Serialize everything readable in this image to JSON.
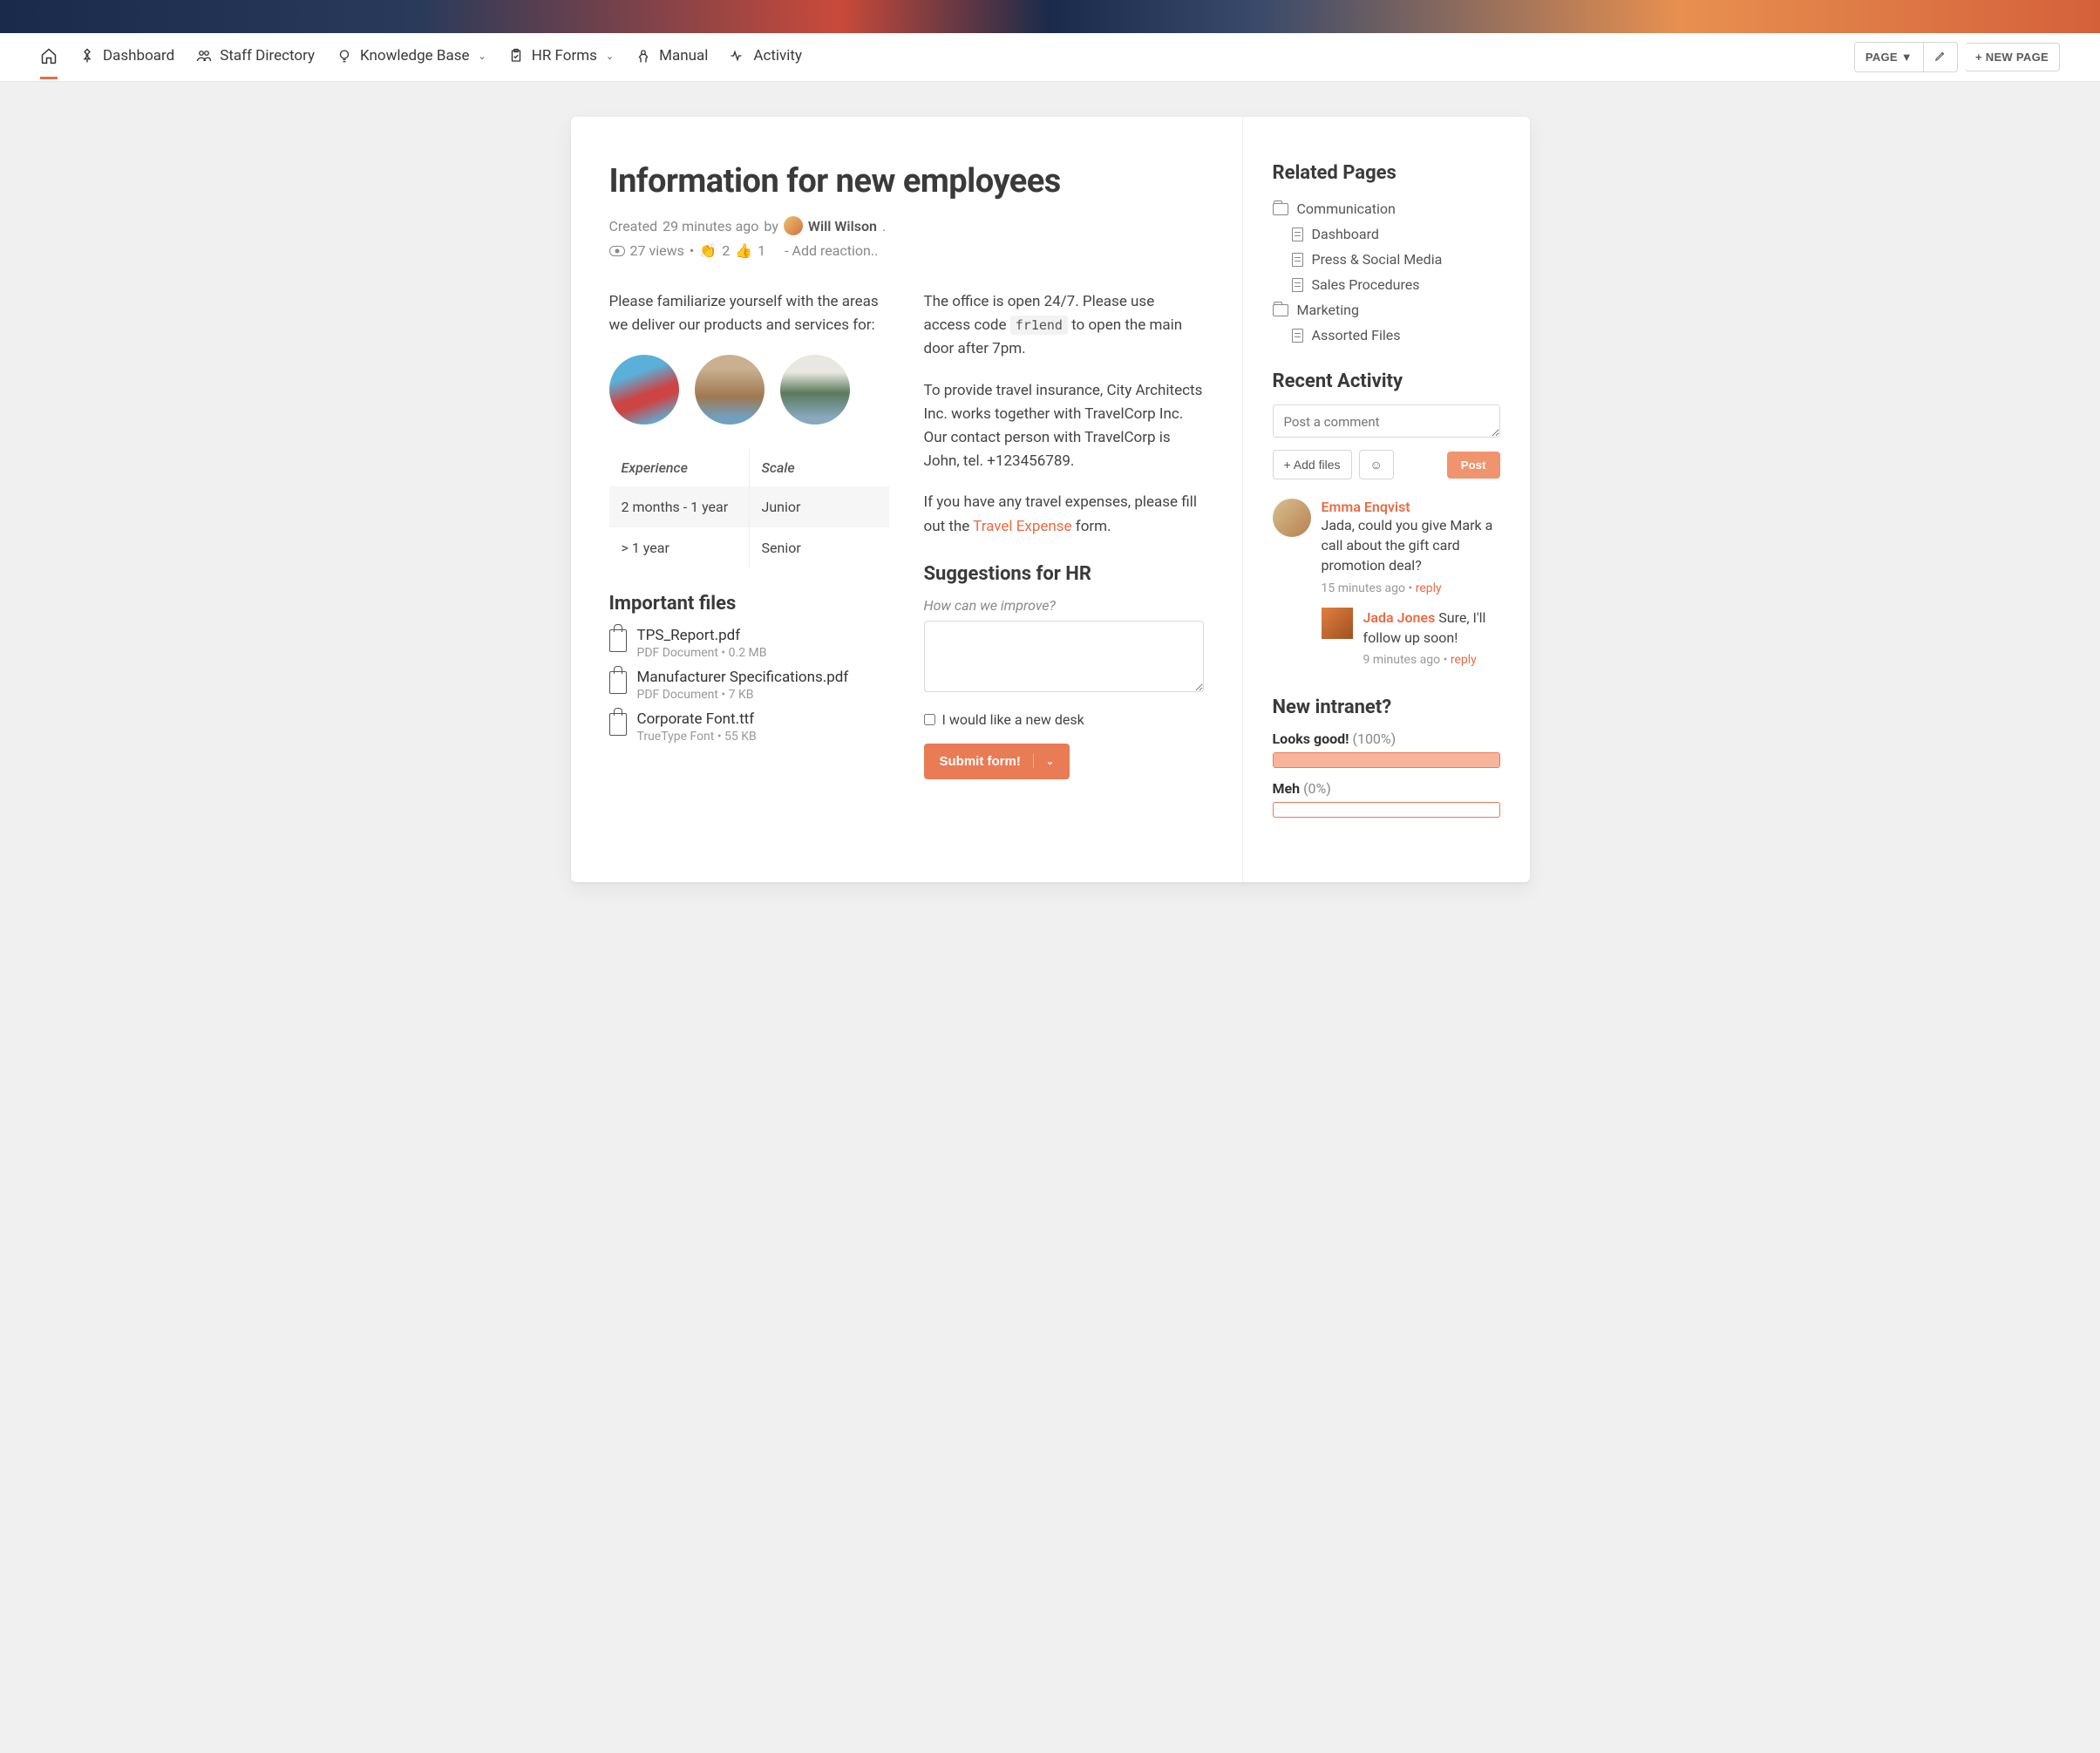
{
  "nav": {
    "items": [
      {
        "label": ""
      },
      {
        "label": "Dashboard"
      },
      {
        "label": "Staff Directory"
      },
      {
        "label": "Knowledge Base"
      },
      {
        "label": "HR Forms"
      },
      {
        "label": "Manual"
      },
      {
        "label": "Activity"
      }
    ],
    "page_btn": "PAGE ▼",
    "new_page_btn": "+ NEW PAGE"
  },
  "page": {
    "title": "Information for new employees",
    "created_prefix": "Created ",
    "created_time": "29 minutes ago",
    "created_by": " by ",
    "author": "Will Wilson",
    "author_suffix": ".",
    "views": "27 views",
    "clap_count": "2",
    "thumb_count": "1",
    "add_reaction": "- Add reaction.."
  },
  "left": {
    "intro": "Please familiarize yourself with the areas we deliver our products and services for:",
    "table": {
      "headers": [
        "Experience",
        "Scale"
      ],
      "rows": [
        [
          "2 months - 1 year",
          "Junior"
        ],
        [
          "> 1 year",
          "Senior"
        ]
      ]
    },
    "files_heading": "Important files",
    "files": [
      {
        "name": "TPS_Report.pdf",
        "meta": "PDF Document • 0.2 MB"
      },
      {
        "name": "Manufacturer Specifications.pdf",
        "meta": "PDF Document • 7 KB"
      },
      {
        "name": "Corporate Font.ttf",
        "meta": "TrueType Font • 55 KB"
      }
    ]
  },
  "right": {
    "office_p1a": "The office is open 24/7. Please use access code ",
    "office_code": "fr1end",
    "office_p1b": " to open the main door after 7pm.",
    "insurance": "To provide travel insurance, City Architects Inc. works together with TravelCorp Inc. Our contact person with TravelCorp is John, tel. +123456789.",
    "expense_a": "If you have any travel expenses, please fill out the ",
    "expense_link": "Travel Expense",
    "expense_b": " form.",
    "suggestions_heading": "Suggestions for HR",
    "improve_label": "How can we improve?",
    "checkbox_label": "I would like a new desk",
    "submit_label": "Submit form!"
  },
  "sidebar": {
    "related_heading": "Related Pages",
    "tree": [
      {
        "type": "folder",
        "label": "Communication"
      },
      {
        "type": "doc",
        "label": "Dashboard",
        "child": true
      },
      {
        "type": "doc",
        "label": "Press & Social Media",
        "child": true
      },
      {
        "type": "doc",
        "label": "Sales Procedures",
        "child": true
      },
      {
        "type": "folder",
        "label": "Marketing"
      },
      {
        "type": "doc",
        "label": "Assorted Files",
        "child": true
      }
    ],
    "recent_heading": "Recent Activity",
    "comment_placeholder": "Post a comment",
    "add_files": "+ Add files",
    "emoji_btn": "☺",
    "post_btn": "Post",
    "comments": [
      {
        "name": "Emma Enqvist",
        "text": "Jada, could you give Mark a call about the gift card promotion deal?",
        "time": "15 minutes ago",
        "reply": "reply"
      }
    ],
    "nested": {
      "name": "Jada Jones",
      "text": " Sure, I'll follow up soon!",
      "time": "9 minutes ago",
      "reply": "reply"
    },
    "poll_heading": "New intranet?",
    "poll": [
      {
        "label": "Looks good!",
        "pct_text": "(100%)",
        "pct": 100
      },
      {
        "label": "Meh",
        "pct_text": "(0%)",
        "pct": 0
      }
    ]
  }
}
